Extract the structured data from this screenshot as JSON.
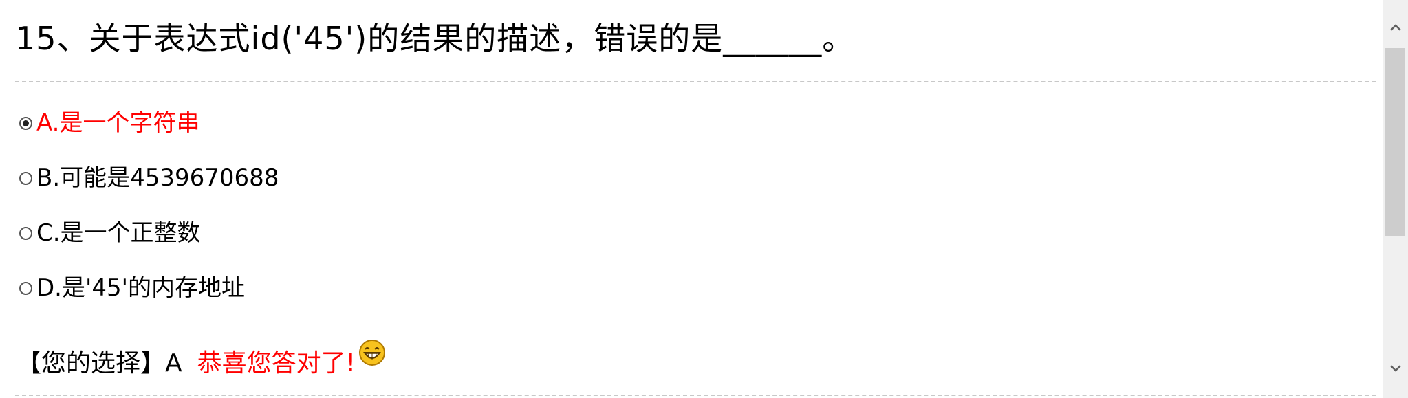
{
  "question": {
    "text": "15、关于表达式id('45')的结果的描述，错误的是______。"
  },
  "options": [
    {
      "label": "A.是一个字符串",
      "checked": true
    },
    {
      "label": "B.可能是4539670688",
      "checked": false
    },
    {
      "label": "C.是一个正整数",
      "checked": false
    },
    {
      "label": "D.是'45'的内存地址",
      "checked": false
    }
  ],
  "result": {
    "your_choice": "【您的选择】A",
    "feedback": "恭喜您答对了!",
    "emoji_icon": "grinning-face-icon"
  },
  "colors": {
    "correct": "#ff0000",
    "divider": "#c8c8c8"
  },
  "scrollbar": {
    "up_icon": "chevron-up-icon",
    "down_icon": "chevron-down-icon"
  }
}
